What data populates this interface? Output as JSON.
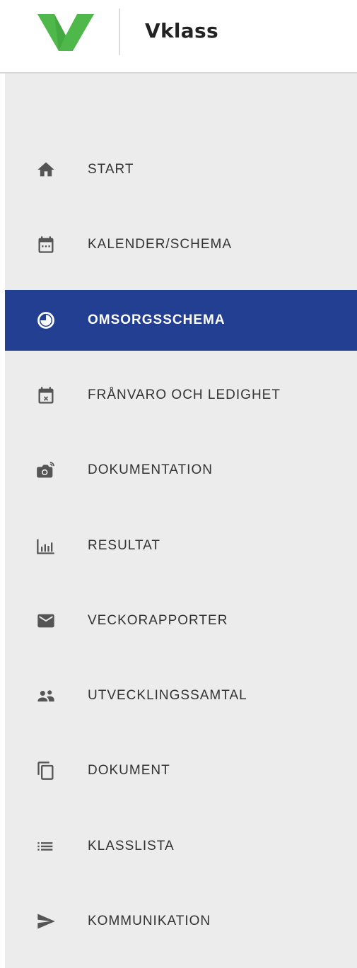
{
  "header": {
    "brand": "Vklass",
    "logo_icon": "vklass-logo-icon",
    "logo_color": "#4fb84a"
  },
  "colors": {
    "active_bg": "#233f92",
    "sidebar_bg": "#ececec",
    "icon": "#555555"
  },
  "sidebar": {
    "items": [
      {
        "label": "START",
        "icon": "home-icon",
        "active": false
      },
      {
        "label": "KALENDER/SCHEMA",
        "icon": "calendar-icon",
        "active": false
      },
      {
        "label": "OMSORGSSCHEMA",
        "icon": "clock-icon",
        "active": true
      },
      {
        "label": "FRÅNVARO OCH LEDIGHET",
        "icon": "calendar-cancel-icon",
        "active": false
      },
      {
        "label": "DOKUMENTATION",
        "icon": "camera-icon",
        "active": false
      },
      {
        "label": "RESULTAT",
        "icon": "bar-chart-icon",
        "active": false
      },
      {
        "label": "VECKORAPPORTER",
        "icon": "mail-icon",
        "active": false
      },
      {
        "label": "UTVECKLINGSSAMTAL",
        "icon": "people-icon",
        "active": false
      },
      {
        "label": "DOKUMENT",
        "icon": "copy-icon",
        "active": false
      },
      {
        "label": "KLASSLISTA",
        "icon": "list-icon",
        "active": false
      },
      {
        "label": "KOMMUNIKATION",
        "icon": "send-icon",
        "active": false
      }
    ]
  }
}
